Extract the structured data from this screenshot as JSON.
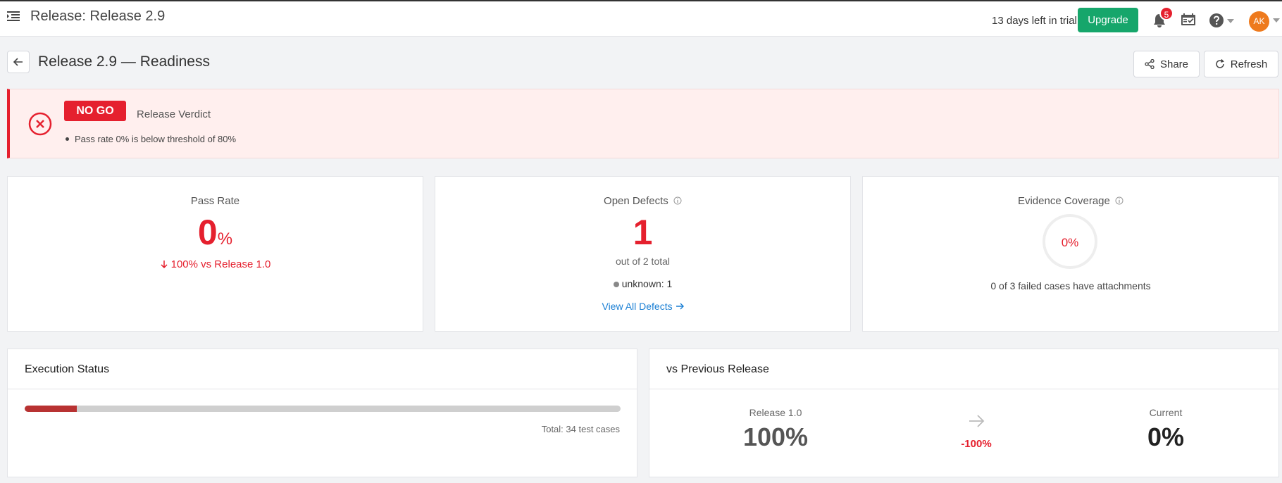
{
  "header": {
    "title": "Release: Release 2.9",
    "trial_text": "13 days left in trial",
    "upgrade_label": "Upgrade",
    "notification_count": "5",
    "avatar_initials": "AK"
  },
  "page": {
    "title": "Release 2.9 — Readiness",
    "share_label": "Share",
    "refresh_label": "Refresh"
  },
  "verdict": {
    "status": "NO GO",
    "label": "Release Verdict",
    "reasons": [
      "Pass rate 0% is below threshold of 80%"
    ]
  },
  "cards": {
    "pass_rate": {
      "title": "Pass Rate",
      "value": "0",
      "unit": "%",
      "delta": "100% vs Release 1.0"
    },
    "open_defects": {
      "title": "Open Defects",
      "value": "1",
      "subtitle": "out of 2 total",
      "breakdown": "unknown: 1",
      "link_label": "View All Defects"
    },
    "evidence": {
      "title": "Evidence Coverage",
      "value": "0%",
      "subtitle": "0 of 3 failed cases have attachments"
    }
  },
  "execution": {
    "title": "Execution Status",
    "failed_fraction": 0.088,
    "total_label": "Total: 34 test cases"
  },
  "comparison": {
    "title": "vs Previous Release",
    "previous_label": "Release 1.0",
    "previous_value": "100%",
    "delta": "-100%",
    "current_label": "Current",
    "current_value": "0%"
  },
  "colors": {
    "danger": "#e5202e",
    "success": "#16a66b",
    "link": "#1a7fd4",
    "progress_failed": "#b83232",
    "avatar": "#ee7a1d"
  }
}
